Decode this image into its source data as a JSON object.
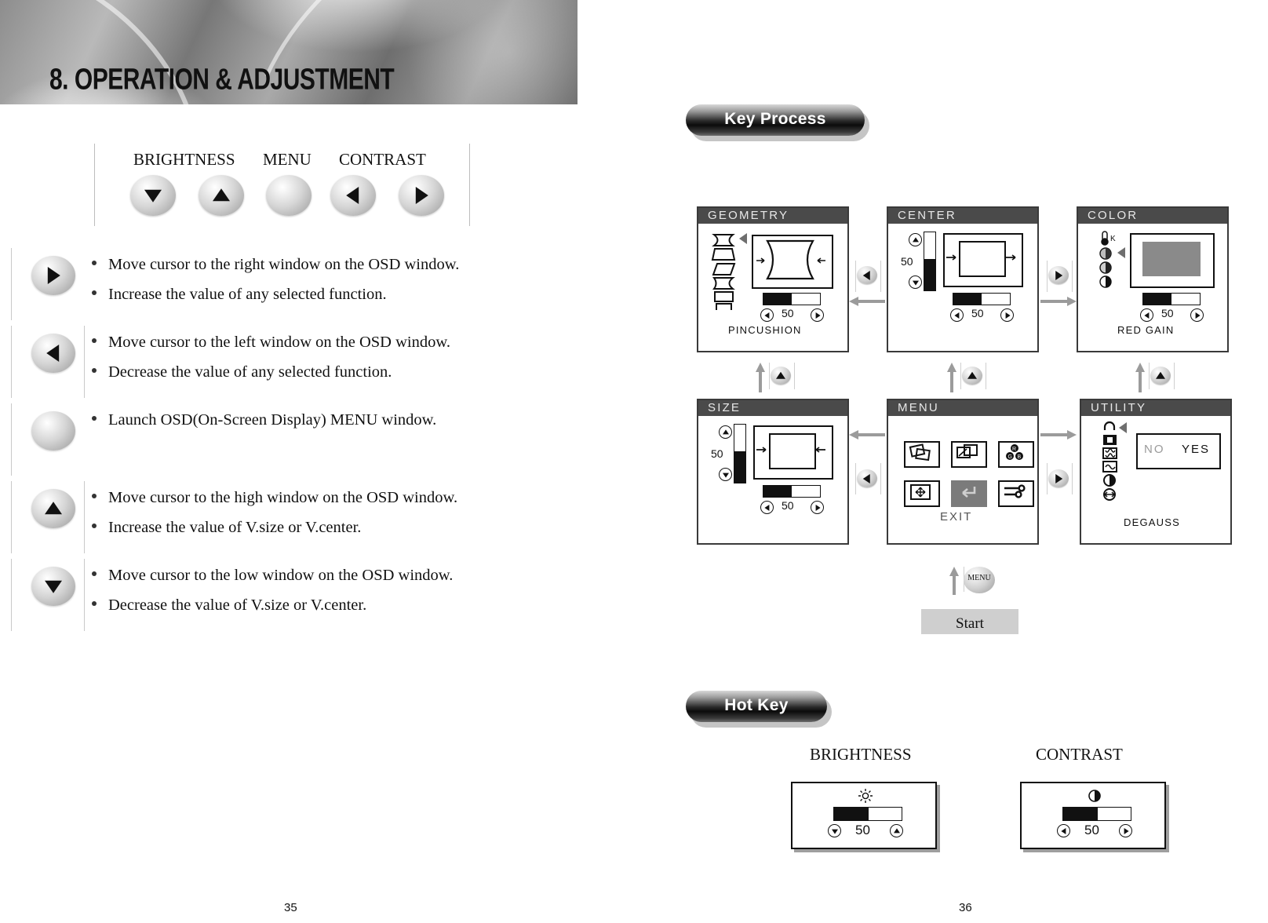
{
  "left_page": {
    "banner_title": "8. OPERATION & ADJUSTMENT",
    "page_number": "35",
    "key_panel": {
      "labels": [
        {
          "name": "brightness",
          "text": "BRIGHTNESS"
        },
        {
          "name": "menu",
          "text": "MENU"
        },
        {
          "name": "contrast",
          "text": "CONTRAST"
        }
      ],
      "buttons": [
        "down-arrow",
        "up-arrow",
        "menu-round",
        "left-arrow",
        "right-arrow"
      ]
    },
    "instructions": [
      {
        "icon": "right-arrow-button",
        "lines": [
          "Move cursor to the right window on the OSD window.",
          "Increase the value of any selected function."
        ]
      },
      {
        "icon": "left-arrow-button",
        "lines": [
          "Move cursor to the left window on the OSD window.",
          "Decrease the value of any selected  function."
        ]
      },
      {
        "icon": "menu-round-button",
        "lines": [
          "Launch OSD(On-Screen Display) MENU window."
        ]
      },
      {
        "icon": "up-arrow-button",
        "lines": [
          "Move cursor to the high window on the OSD window.",
          "Increase the value of V.size or V.center."
        ]
      },
      {
        "icon": "down-arrow-button",
        "lines": [
          "Move cursor to the low window on the OSD window.",
          "Decrease the value of V.size or V.center."
        ]
      }
    ]
  },
  "right_page": {
    "page_number": "36",
    "key_process_title": "Key Process",
    "hot_key_title": "Hot Key",
    "start_label": "Start",
    "menu_key_label": "MENU",
    "osd_panels": [
      {
        "id": "geometry",
        "title": "GEOMETRY",
        "caption": "PINCUSHION",
        "value": "50"
      },
      {
        "id": "center",
        "title": "CENTER",
        "caption": "",
        "value": "50",
        "vvalue": "50"
      },
      {
        "id": "color",
        "title": "COLOR",
        "caption": "RED GAIN",
        "value": "50"
      },
      {
        "id": "size",
        "title": "SIZE",
        "caption": "",
        "value": "50",
        "vvalue": "50"
      },
      {
        "id": "menu",
        "title": "MENU",
        "caption": "EXIT",
        "value": ""
      },
      {
        "id": "utility",
        "title": "UTILITY",
        "caption": "DEGAUSS",
        "value": "",
        "no_label": "NO",
        "yes_label": "YES"
      }
    ],
    "hot_keys": [
      {
        "id": "brightness",
        "label": "BRIGHTNESS",
        "icon": "sun-icon",
        "value": "50",
        "left_arrow": "down-arrow",
        "right_arrow": "up-arrow"
      },
      {
        "id": "contrast",
        "label": "CONTRAST",
        "icon": "half-circle-icon",
        "value": "50",
        "left_arrow": "left-arrow",
        "right_arrow": "right-arrow"
      }
    ]
  },
  "colors": {
    "osd_titlebar": "#4a4a4a",
    "pill_dark": "#0b0b0b",
    "start_box": "#cfcfcf",
    "nav_arrow_gray": "#9b9b9b",
    "color_swatch": "#8a8a8a"
  }
}
